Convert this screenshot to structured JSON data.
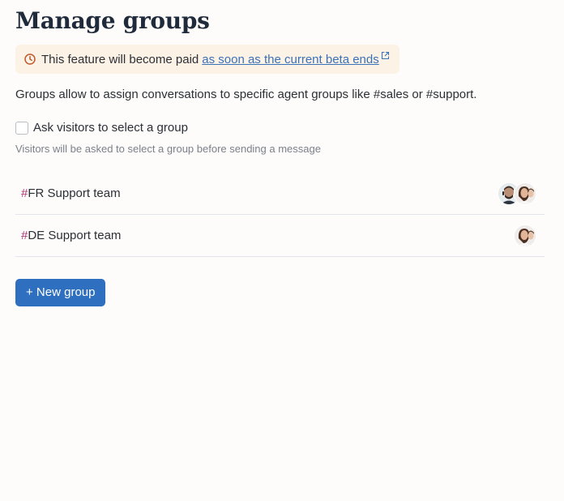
{
  "page": {
    "title": "Manage groups",
    "notice": {
      "text": "This feature will become paid",
      "link_label": "as soon as the current beta ends",
      "icon": "clock-icon",
      "link_icon": "external-link-icon"
    },
    "description": "Groups allow to assign conversations to specific agent groups like #sales or #support.",
    "select_group": {
      "label": "Ask visitors to select a group",
      "checked": false,
      "hint": "Visitors will be asked to select a group before sending a message"
    },
    "groups": [
      {
        "hash": "#",
        "name": "FR Support team",
        "avatar_count": 2
      },
      {
        "hash": "#",
        "name": "DE Support team",
        "avatar_count": 1
      }
    ],
    "new_group_label": "+ New group"
  },
  "colors": {
    "accent": "#2f6fbf",
    "link": "#3a72b8",
    "hash": "#b0306f",
    "notice_bg": "#fdf2e6"
  }
}
